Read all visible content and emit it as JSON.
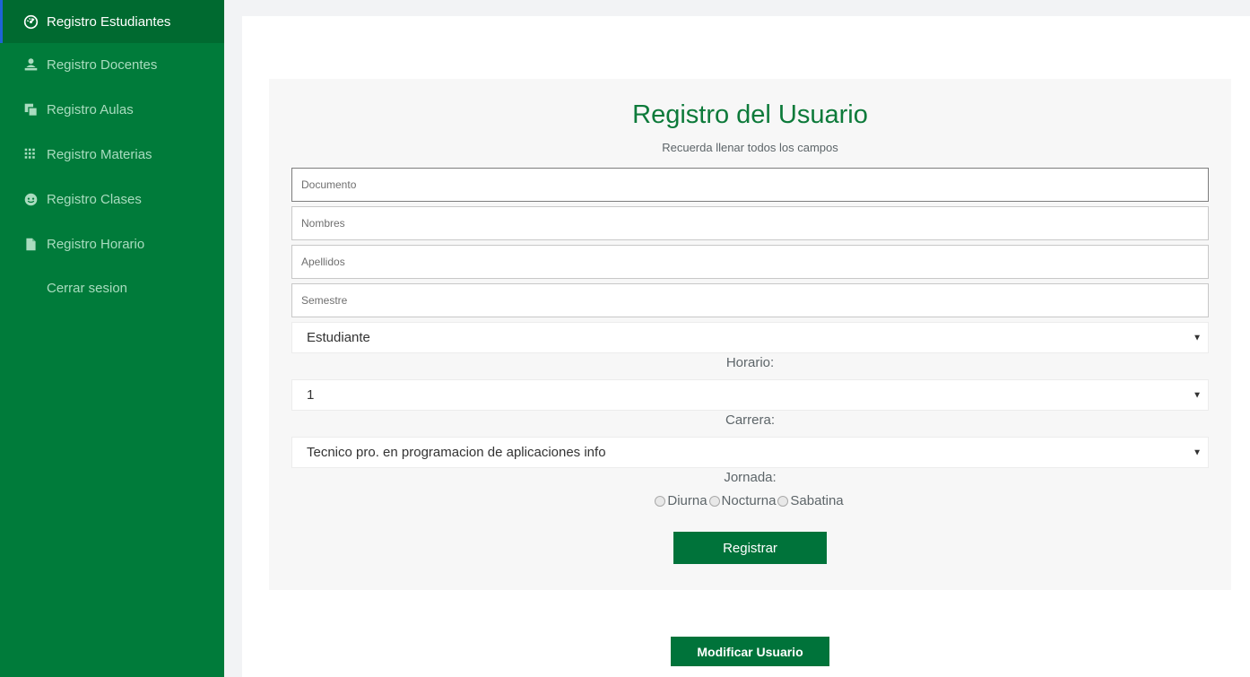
{
  "sidebar": {
    "items": [
      {
        "label": "Registro Estudiantes",
        "icon": "dashboard-icon",
        "active": true
      },
      {
        "label": "Registro Docentes",
        "icon": "teacher-icon",
        "active": false
      },
      {
        "label": "Registro Aulas",
        "icon": "classroom-icon",
        "active": false
      },
      {
        "label": "Registro Materias",
        "icon": "grid-icon",
        "active": false
      },
      {
        "label": "Registro Clases",
        "icon": "face-icon",
        "active": false
      },
      {
        "label": "Registro Horario",
        "icon": "document-icon",
        "active": false
      },
      {
        "label": "Cerrar sesion",
        "icon": "",
        "active": false
      }
    ]
  },
  "form": {
    "title": "Registro del Usuario",
    "subtitle": "Recuerda llenar todos los campos",
    "fields": {
      "documento_placeholder": "Documento",
      "nombres_placeholder": "Nombres",
      "apellidos_placeholder": "Apellidos",
      "semestre_placeholder": "Semestre"
    },
    "rol_select": "Estudiante",
    "horario_label": "Horario:",
    "horario_select": "1",
    "carrera_label": "Carrera:",
    "carrera_select": "Tecnico pro. en programacion de aplicaciones info",
    "jornada_label": "Jornada:",
    "jornada_options": [
      "Diurna",
      "Nocturna",
      "Sabatina"
    ],
    "register_button": "Registrar"
  },
  "modify_button": "Modificar Usuario",
  "colors": {
    "sidebar_bg": "#007b3a",
    "sidebar_active_bg": "#006a30",
    "accent_green": "#00733a",
    "title_green": "#0d7a3a"
  }
}
